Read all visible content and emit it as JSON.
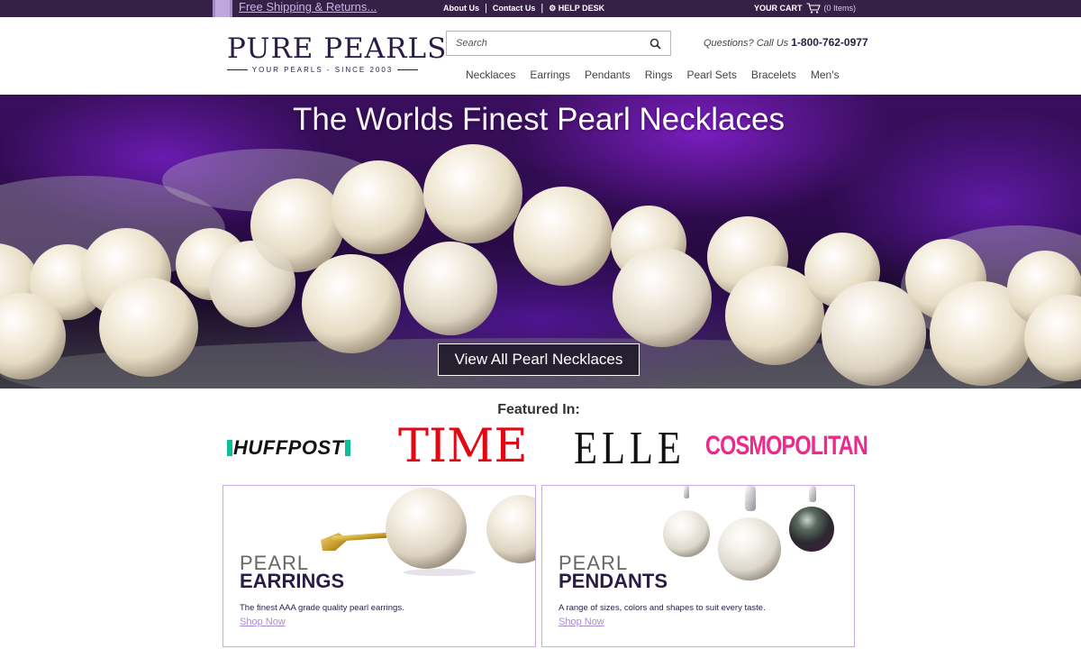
{
  "topbar": {
    "shipping_link": "Free Shipping & Returns...",
    "about": "About Us",
    "contact": "Contact Us",
    "helpdesk": "⚙ HELP DESK",
    "cart_label": "YOUR CART",
    "cart_count": "(0 Items)"
  },
  "header": {
    "logo_main": "PURE PEARLS",
    "logo_sub": "YOUR PEARLS - SINCE 2003",
    "search_placeholder": "Search",
    "phone_question": "Questions? Call Us",
    "phone_number": "1-800-762-0977"
  },
  "nav": [
    "Necklaces",
    "Earrings",
    "Pendants",
    "Rings",
    "Pearl Sets",
    "Bracelets",
    "Men's"
  ],
  "hero": {
    "title_part1": "The Worlds Finest",
    "title_part2": "Pearl Necklaces",
    "button": "View All Pearl Necklaces"
  },
  "featured": {
    "title": "Featured In:",
    "logos": {
      "huffpost": "HUFFPOST",
      "time": "TIME",
      "elle": "ELLE",
      "cosmo": "COSMOPOLITAN"
    }
  },
  "cards": [
    {
      "thin": "PEARL",
      "bold": "EARRINGS",
      "desc": "The finest AAA grade quality pearl earrings.",
      "link": "Shop Now"
    },
    {
      "thin": "PEARL",
      "bold": "PENDANTS",
      "desc": "A range of sizes, colors and shapes to suit every taste.",
      "link": "Shop Now"
    }
  ],
  "colors": {
    "topbar_bg": "#352146",
    "brand_dark": "#2a1d45",
    "accent_purple": "#a98bd6",
    "card_border": "#c7a9e8",
    "time_red": "#e30613",
    "cosmo_pink": "#ea2b8c",
    "huff_green": "#0dbe98"
  },
  "icons": [
    "ribbon-icon",
    "cart-icon",
    "search-icon"
  ]
}
